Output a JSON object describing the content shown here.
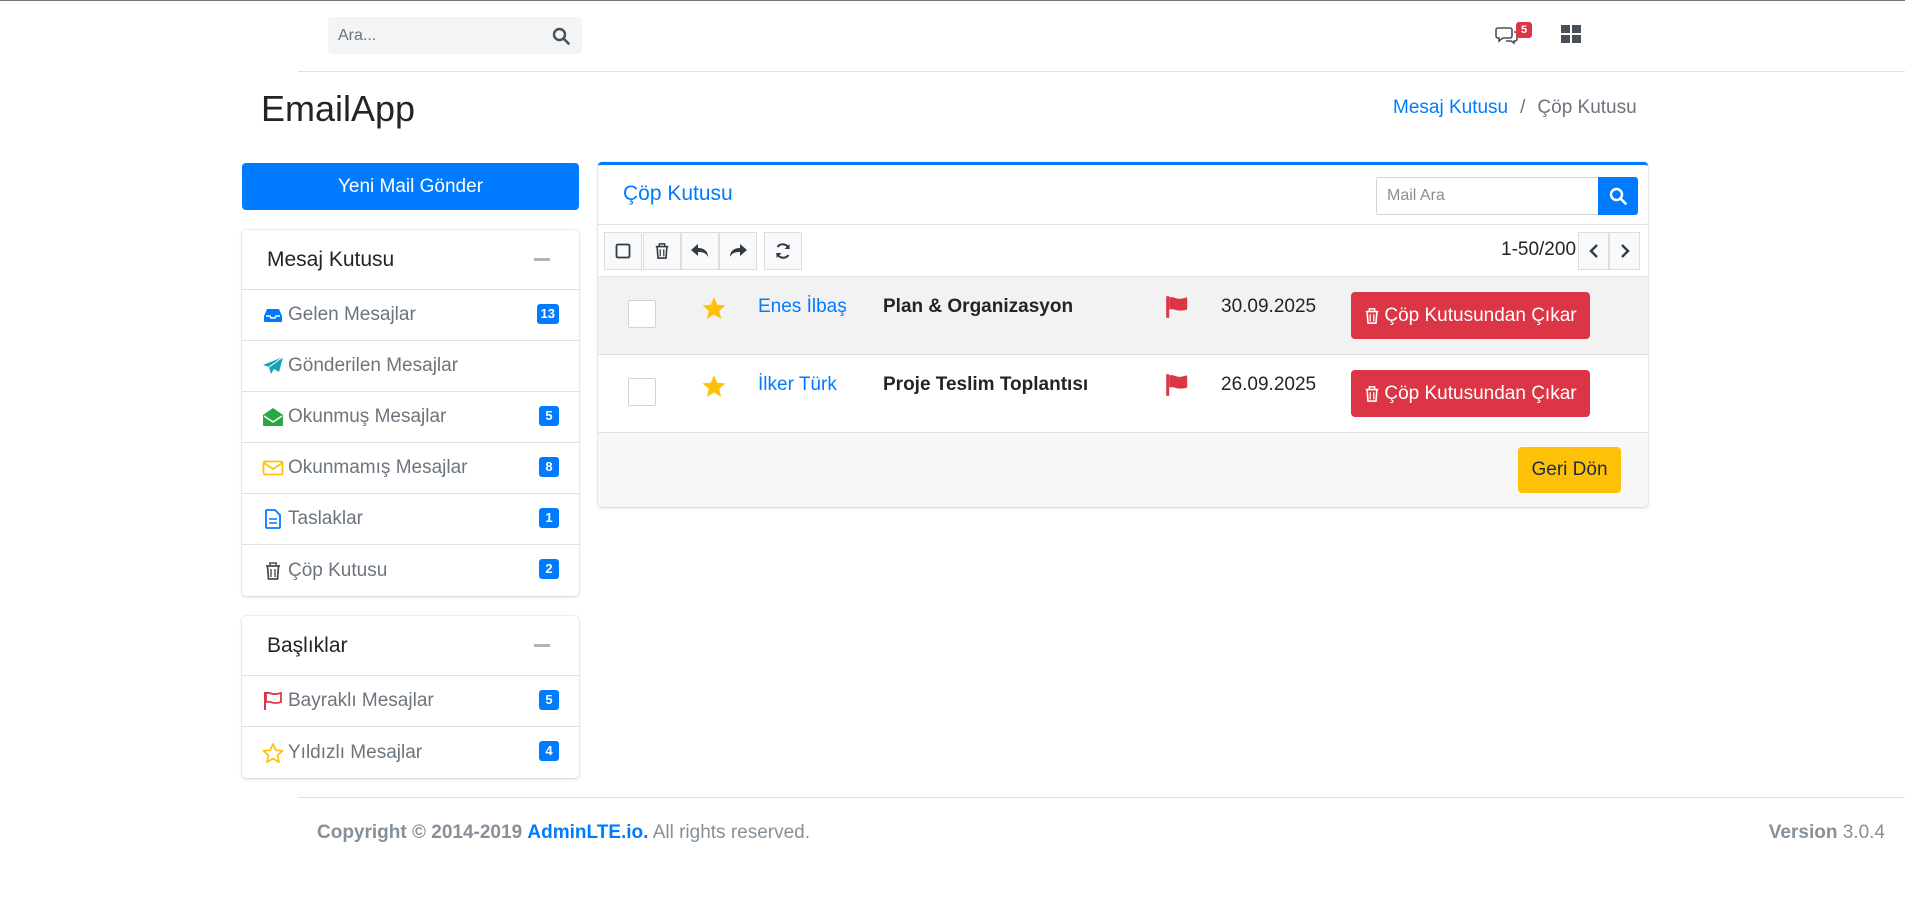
{
  "topbar": {
    "search_placeholder": "Ara...",
    "messages_badge": "5"
  },
  "app": {
    "title": "EmailApp"
  },
  "breadcrumb": {
    "items": [
      "Mesaj Kutusu",
      "Çöp Kutusu"
    ]
  },
  "sidebar": {
    "compose_label": "Yeni Mail Gönder",
    "folders": {
      "title": "Mesaj Kutusu",
      "items": [
        {
          "label": "Gelen Mesajlar",
          "icon": "inbox-icon",
          "count": "13",
          "color": "#007bff"
        },
        {
          "label": "Gönderilen Mesajlar",
          "icon": "paper-plane-icon",
          "count": "",
          "color": "#17a2b8"
        },
        {
          "label": "Okunmuş Mesajlar",
          "icon": "envelope-open-icon",
          "count": "5",
          "color": "#28a745"
        },
        {
          "label": "Okunmamış Mesajlar",
          "icon": "envelope-icon",
          "count": "8",
          "color": "#ffc107"
        },
        {
          "label": "Taslaklar",
          "icon": "file-icon",
          "count": "1",
          "color": "#007bff"
        },
        {
          "label": "Çöp Kutusu",
          "icon": "trash-icon",
          "count": "2",
          "color": "#6c757d"
        }
      ]
    },
    "labels": {
      "title": "Başlıklar",
      "items": [
        {
          "label": "Bayraklı Mesajlar",
          "icon": "flag-icon",
          "count": "5",
          "color": "#dc3545"
        },
        {
          "label": "Yıldızlı Mesajlar",
          "icon": "star-icon",
          "count": "4",
          "color": "#ffc107"
        }
      ]
    }
  },
  "mailbox": {
    "title": "Çöp Kutusu",
    "search_placeholder": "Mail Ara",
    "pager": "1-50/200",
    "rows": [
      {
        "sender": "Enes İlbaş",
        "subject": "Plan & Organizasyon",
        "date": "30.09.2025",
        "starred": true,
        "flagged": true,
        "action": "Çöp Kutusundan Çıkar"
      },
      {
        "sender": "İlker Türk",
        "subject": "Proje Teslim Toplantısı",
        "date": "26.09.2025",
        "starred": true,
        "flagged": true,
        "action": "Çöp Kutusundan Çıkar"
      }
    ],
    "back_label": "Geri Dön"
  },
  "footer": {
    "copyright_prefix": "Copyright © 2014-2019",
    "brand": "AdminLTE.io.",
    "rights": "All rights reserved.",
    "version_label": "Version",
    "version_value": "3.0.4"
  },
  "colors": {
    "primary": "#007bff",
    "danger": "#dc3545",
    "warning": "#ffc107"
  }
}
